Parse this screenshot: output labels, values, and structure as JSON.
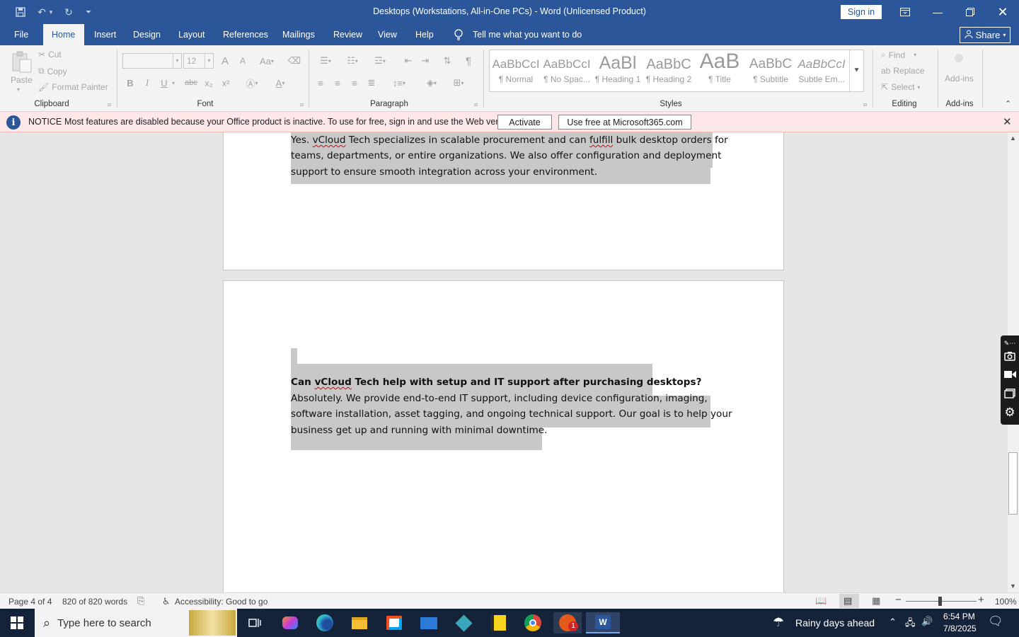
{
  "window": {
    "title": "Desktops (Workstations, All-in-One PCs)  -  Word (Unlicensed Product)",
    "sign_in": "Sign in",
    "share": "Share"
  },
  "tabs": [
    "File",
    "Home",
    "Insert",
    "Design",
    "Layout",
    "References",
    "Mailings",
    "Review",
    "View",
    "Help"
  ],
  "tell_me": "Tell me what you want to do",
  "ribbon": {
    "clipboard": {
      "label": "Clipboard",
      "paste": "Paste",
      "cut": "Cut",
      "copy": "Copy",
      "format_painter": "Format Painter"
    },
    "font": {
      "label": "Font",
      "size": "12",
      "bold": "B",
      "italic": "I",
      "underline": "U",
      "strike": "abc",
      "sub": "x₂",
      "sup": "x²",
      "grow": "A",
      "shrink": "A",
      "case": "Aa"
    },
    "paragraph": {
      "label": "Paragraph"
    },
    "styles": {
      "label": "Styles",
      "items": [
        {
          "preview": "AaBbCcI",
          "name": "¶ Normal"
        },
        {
          "preview": "AaBbCcI",
          "name": "¶ No Spac..."
        },
        {
          "preview": "AaBl",
          "name": "¶ Heading 1"
        },
        {
          "preview": "AaBbC",
          "name": "¶ Heading 2"
        },
        {
          "preview": "AaB",
          "name": "¶ Title"
        },
        {
          "preview": "AaBbC",
          "name": "¶ Subtitle"
        },
        {
          "preview": "AaBbCcI",
          "name": "Subtle Em..."
        }
      ]
    },
    "editing": {
      "label": "Editing",
      "find": "Find",
      "replace": "Replace",
      "select": "Select"
    },
    "addins": {
      "label": "Add-ins",
      "button": "Add-ins"
    }
  },
  "notice": {
    "title": "NOTICE",
    "text": "Most features are disabled because your Office product is inactive. To use for free, sign in and use the Web version.",
    "activate": "Activate",
    "web": "Use free at Microsoft365.com"
  },
  "document": {
    "p1": {
      "pre": " Yes. ",
      "s1": "vCloud",
      "mid": " Tech specializes in scalable procurement and can ",
      "s2": "fulfill",
      "post": " bulk desktop orders for",
      "l2": "teams, departments, or entire organizations. We also offer configuration and deployment",
      "l3": "support to ensure smooth integration across your environment."
    },
    "q2": {
      "pre": "Can ",
      "s1": "vCloud",
      "post": " Tech help with setup and IT support after purchasing desktops?"
    },
    "a2": {
      "l1": " Absolutely. We provide end-to-end IT support, including device configuration, imaging,",
      "l2": "software installation, asset tagging, and ongoing technical support. Our goal is to help your",
      "l3": "business get up and running with minimal downtime."
    }
  },
  "status": {
    "page": "Page 4 of 4",
    "words": "820 of 820 words",
    "accessibility": "Accessibility: Good to go",
    "zoom": "100%"
  },
  "taskbar": {
    "search_placeholder": "Type here to search",
    "weather": "Rainy days ahead",
    "time": "6:54 PM",
    "date": "7/8/2025",
    "zoom_badge": "1"
  }
}
